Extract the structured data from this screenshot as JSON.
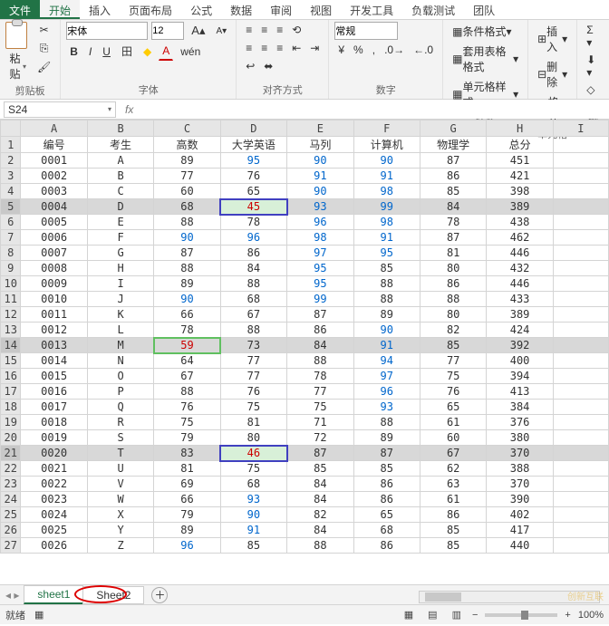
{
  "tabs": {
    "file": "文件",
    "home": "开始",
    "insert": "插入",
    "layout": "页面布局",
    "formula": "公式",
    "data": "数据",
    "review": "审阅",
    "view": "视图",
    "dev": "开发工具",
    "load": "负载测试",
    "team": "团队"
  },
  "ribbon": {
    "clipboard": {
      "paste": "粘贴",
      "label": "剪贴板"
    },
    "font": {
      "name": "宋体",
      "size": "12",
      "label": "字体",
      "bold": "B",
      "italic": "I",
      "underline": "U",
      "border": "田",
      "fill": "⬛",
      "color": "A",
      "ruby": "wén",
      "grow": "A",
      "shrink": "A"
    },
    "align": {
      "label": "对齐方式"
    },
    "number": {
      "format": "常规",
      "label": "数字",
      "percent": "%",
      "comma": ",",
      "inc": ".0",
      "dec": ".00"
    },
    "styles": {
      "cond": "条件格式",
      "table": "套用表格格式",
      "cell": "单元格样式",
      "label": "样式"
    },
    "cells": {
      "insert": "插入",
      "delete": "删除",
      "format": "格式",
      "label": "单元格"
    },
    "editing": {
      "label": "编"
    }
  },
  "nameBox": "S24",
  "columns": [
    "A",
    "B",
    "C",
    "D",
    "E",
    "F",
    "G",
    "H",
    "I"
  ],
  "headerRow": [
    "编号",
    "考生",
    "高数",
    "大学英语",
    "马列",
    "计算机",
    "物理学",
    "总分"
  ],
  "rows": [
    {
      "n": 1,
      "d": [
        "编号",
        "考生",
        "高数",
        "大学英语",
        "马列",
        "计算机",
        "物理学",
        "总分"
      ],
      "hdr": true
    },
    {
      "n": 2,
      "d": [
        "0001",
        "A",
        "89",
        "95",
        "90",
        "90",
        "87",
        "451"
      ],
      "b": [
        3,
        4,
        5
      ]
    },
    {
      "n": 3,
      "d": [
        "0002",
        "B",
        "77",
        "76",
        "91",
        "91",
        "86",
        "421"
      ],
      "b": [
        4,
        5
      ]
    },
    {
      "n": 4,
      "d": [
        "0003",
        "C",
        "60",
        "65",
        "90",
        "98",
        "85",
        "398"
      ],
      "b": [
        4,
        5
      ]
    },
    {
      "n": 5,
      "d": [
        "0004",
        "D",
        "68",
        "45",
        "93",
        "99",
        "84",
        "389"
      ],
      "sel": true,
      "b": [
        4,
        5
      ],
      "red": 3
    },
    {
      "n": 6,
      "d": [
        "0005",
        "E",
        "88",
        "78",
        "96",
        "98",
        "78",
        "438"
      ],
      "b": [
        4,
        5
      ]
    },
    {
      "n": 7,
      "d": [
        "0006",
        "F",
        "90",
        "96",
        "98",
        "91",
        "87",
        "462"
      ],
      "b": [
        2,
        3,
        4,
        5
      ]
    },
    {
      "n": 8,
      "d": [
        "0007",
        "G",
        "87",
        "86",
        "97",
        "95",
        "81",
        "446"
      ],
      "b": [
        4,
        5
      ]
    },
    {
      "n": 9,
      "d": [
        "0008",
        "H",
        "88",
        "84",
        "95",
        "85",
        "80",
        "432"
      ],
      "b": [
        4
      ]
    },
    {
      "n": 10,
      "d": [
        "0009",
        "I",
        "89",
        "88",
        "95",
        "88",
        "86",
        "446"
      ],
      "b": [
        4
      ]
    },
    {
      "n": 11,
      "d": [
        "0010",
        "J",
        "90",
        "68",
        "99",
        "88",
        "88",
        "433"
      ],
      "b": [
        2,
        4
      ]
    },
    {
      "n": 12,
      "d": [
        "0011",
        "K",
        "66",
        "67",
        "87",
        "89",
        "80",
        "389"
      ]
    },
    {
      "n": 13,
      "d": [
        "0012",
        "L",
        "78",
        "88",
        "86",
        "90",
        "82",
        "424"
      ],
      "b": [
        5
      ]
    },
    {
      "n": 14,
      "d": [
        "0013",
        "M",
        "59",
        "73",
        "84",
        "91",
        "85",
        "392"
      ],
      "sel": true,
      "b": [
        5
      ],
      "grn": 2
    },
    {
      "n": 15,
      "d": [
        "0014",
        "N",
        "64",
        "77",
        "88",
        "94",
        "77",
        "400"
      ],
      "b": [
        5
      ]
    },
    {
      "n": 16,
      "d": [
        "0015",
        "O",
        "67",
        "77",
        "78",
        "97",
        "75",
        "394"
      ],
      "b": [
        5
      ]
    },
    {
      "n": 17,
      "d": [
        "0016",
        "P",
        "88",
        "76",
        "77",
        "96",
        "76",
        "413"
      ],
      "b": [
        5
      ]
    },
    {
      "n": 18,
      "d": [
        "0017",
        "Q",
        "76",
        "75",
        "75",
        "93",
        "65",
        "384"
      ],
      "b": [
        5
      ]
    },
    {
      "n": 19,
      "d": [
        "0018",
        "R",
        "75",
        "81",
        "71",
        "88",
        "61",
        "376"
      ]
    },
    {
      "n": 20,
      "d": [
        "0019",
        "S",
        "79",
        "80",
        "72",
        "89",
        "60",
        "380"
      ]
    },
    {
      "n": 21,
      "d": [
        "0020",
        "T",
        "83",
        "46",
        "87",
        "87",
        "67",
        "370"
      ],
      "sel": true,
      "red": 3
    },
    {
      "n": 22,
      "d": [
        "0021",
        "U",
        "81",
        "75",
        "85",
        "85",
        "62",
        "388"
      ]
    },
    {
      "n": 23,
      "d": [
        "0022",
        "V",
        "69",
        "68",
        "84",
        "86",
        "63",
        "370"
      ]
    },
    {
      "n": 24,
      "d": [
        "0023",
        "W",
        "66",
        "93",
        "84",
        "86",
        "61",
        "390"
      ],
      "b": [
        3
      ]
    },
    {
      "n": 25,
      "d": [
        "0024",
        "X",
        "79",
        "90",
        "82",
        "65",
        "86",
        "402"
      ],
      "b": [
        3
      ]
    },
    {
      "n": 26,
      "d": [
        "0025",
        "Y",
        "89",
        "91",
        "84",
        "68",
        "85",
        "417"
      ],
      "b": [
        3
      ]
    },
    {
      "n": 27,
      "d": [
        "0026",
        "Z",
        "96",
        "85",
        "88",
        "86",
        "85",
        "440"
      ],
      "b": [
        2
      ]
    }
  ],
  "sheetTabs": {
    "s1": "sheet1",
    "s2": "Sheet2"
  },
  "status": {
    "ready": "就绪",
    "zoom": "100%"
  },
  "watermark": "创新互联",
  "chart_data": {
    "type": "table",
    "title": "",
    "columns": [
      "编号",
      "考生",
      "高数",
      "大学英语",
      "马列",
      "计算机",
      "物理学",
      "总分"
    ],
    "data": [
      [
        "0001",
        "A",
        89,
        95,
        90,
        90,
        87,
        451
      ],
      [
        "0002",
        "B",
        77,
        76,
        91,
        91,
        86,
        421
      ],
      [
        "0003",
        "C",
        60,
        65,
        90,
        98,
        85,
        398
      ],
      [
        "0004",
        "D",
        68,
        45,
        93,
        99,
        84,
        389
      ],
      [
        "0005",
        "E",
        88,
        78,
        96,
        98,
        78,
        438
      ],
      [
        "0006",
        "F",
        90,
        96,
        98,
        91,
        87,
        462
      ],
      [
        "0007",
        "G",
        87,
        86,
        97,
        95,
        81,
        446
      ],
      [
        "0008",
        "H",
        88,
        84,
        95,
        85,
        80,
        432
      ],
      [
        "0009",
        "I",
        89,
        88,
        95,
        88,
        86,
        446
      ],
      [
        "0010",
        "J",
        90,
        68,
        99,
        88,
        88,
        433
      ],
      [
        "0011",
        "K",
        66,
        67,
        87,
        89,
        80,
        389
      ],
      [
        "0012",
        "L",
        78,
        88,
        86,
        90,
        82,
        424
      ],
      [
        "0013",
        "M",
        59,
        73,
        84,
        91,
        85,
        392
      ],
      [
        "0014",
        "N",
        64,
        77,
        88,
        94,
        77,
        400
      ],
      [
        "0015",
        "O",
        67,
        77,
        78,
        97,
        75,
        394
      ],
      [
        "0016",
        "P",
        88,
        76,
        77,
        96,
        76,
        413
      ],
      [
        "0017",
        "Q",
        76,
        75,
        75,
        93,
        65,
        384
      ],
      [
        "0018",
        "R",
        75,
        81,
        71,
        88,
        61,
        376
      ],
      [
        "0019",
        "S",
        79,
        80,
        72,
        89,
        60,
        380
      ],
      [
        "0020",
        "T",
        83,
        46,
        87,
        87,
        67,
        370
      ],
      [
        "0021",
        "U",
        81,
        75,
        85,
        85,
        62,
        388
      ],
      [
        "0022",
        "V",
        69,
        68,
        84,
        86,
        63,
        370
      ],
      [
        "0023",
        "W",
        66,
        93,
        84,
        86,
        61,
        390
      ],
      [
        "0024",
        "X",
        79,
        90,
        82,
        65,
        86,
        402
      ],
      [
        "0025",
        "Y",
        89,
        91,
        84,
        68,
        85,
        417
      ],
      [
        "0026",
        "Z",
        96,
        85,
        88,
        86,
        85,
        440
      ]
    ]
  }
}
